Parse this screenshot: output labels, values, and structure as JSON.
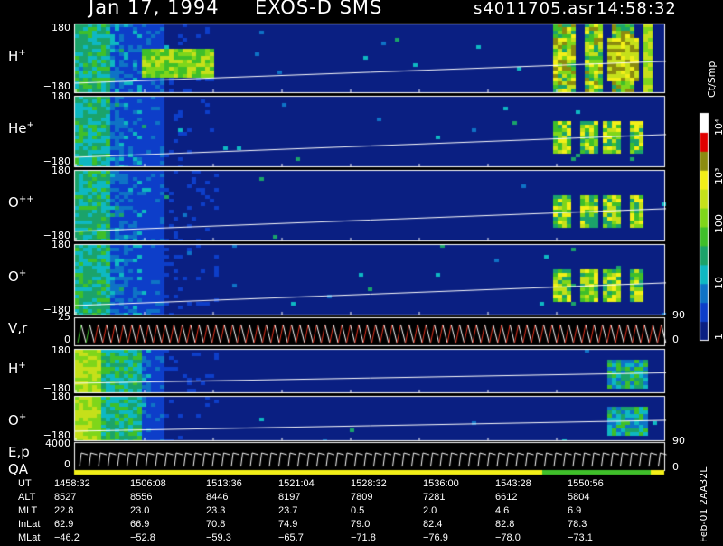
{
  "header": {
    "date": "Jan 17, 1994",
    "mission": "EXOS-D SMS",
    "file": "s4011705.asr",
    "time": "14:58:32"
  },
  "side_labels": {
    "colorbar_unit": "Ct/Smp",
    "footer_id": "Feb-01 2AA32L"
  },
  "colors": {
    "background": "#000000",
    "spectrogram_floor": "#0a1f82",
    "trace": "#ffffff",
    "pitch_trace": "#e8321e"
  },
  "chart_data": {
    "type": "heatmap",
    "panels": [
      {
        "id": "h-plus-1",
        "label_base": "H",
        "label_sup": "+",
        "y_top": "180",
        "y_bottom": "−180",
        "ylim": [
          -180,
          180
        ],
        "intensity": "full"
      },
      {
        "id": "he-plus",
        "label_base": "He",
        "label_sup": "+",
        "y_top": "180",
        "y_bottom": "−180",
        "ylim": [
          -180,
          180
        ],
        "intensity": "heavy"
      },
      {
        "id": "o-plus-plus",
        "label_base": "O",
        "label_sup": "++",
        "y_top": "180",
        "y_bottom": "−180",
        "ylim": [
          -180,
          180
        ],
        "intensity": "heavy"
      },
      {
        "id": "o-plus-1",
        "label_base": "O",
        "label_sup": "+",
        "y_top": "180",
        "y_bottom": "−180",
        "ylim": [
          -180,
          180
        ],
        "intensity": "heavy"
      },
      {
        "id": "vr",
        "label_base": "V,r",
        "label_sup": "",
        "y_top": "25",
        "y_bottom": "0",
        "right_tick": "90",
        "right_tick_bottom": "0"
      },
      {
        "id": "h-plus-2",
        "label_base": "H",
        "label_sup": "+",
        "y_top": "180",
        "y_bottom": "−180",
        "ylim": [
          -180,
          180
        ],
        "intensity": "low"
      },
      {
        "id": "o-plus-2",
        "label_base": "O",
        "label_sup": "+",
        "y_top": "180",
        "y_bottom": "−180",
        "ylim": [
          -180,
          180
        ],
        "intensity": "low"
      },
      {
        "id": "ep-qa",
        "label_base": "E,p",
        "label_sub": "QA",
        "y_top": "4000",
        "y_bottom": "0",
        "right_tick": "90",
        "right_tick_bottom": "0"
      }
    ],
    "colorbar": {
      "scale": "log",
      "range": [
        1,
        20000
      ],
      "ticks": [
        {
          "label": "1",
          "value": 1
        },
        {
          "label": "10",
          "value": 10
        },
        {
          "label": "100",
          "value": 100
        },
        {
          "label": "10³",
          "value": 1000
        },
        {
          "label": "10⁴",
          "value": 10000
        }
      ]
    },
    "time_axis": {
      "rows": [
        {
          "label": "UT",
          "values": [
            "1458:32",
            "1506:08",
            "1513:36",
            "1521:04",
            "1528:32",
            "1536:00",
            "1543:28",
            "1550:56"
          ]
        },
        {
          "label": "ALT",
          "values": [
            "8527",
            "8556",
            "8446",
            "8197",
            "7809",
            "7281",
            "6612",
            "5804"
          ]
        },
        {
          "label": "MLT",
          "values": [
            "22.8",
            "23.0",
            "23.3",
            "23.7",
            "0.5",
            "2.0",
            "4.6",
            "6.9"
          ]
        },
        {
          "label": "InLat",
          "values": [
            "62.9",
            "66.9",
            "70.8",
            "74.9",
            "79.0",
            "82.4",
            "82.8",
            "78.3"
          ]
        },
        {
          "label": "MLat",
          "values": [
            "−46.2",
            "−52.8",
            "−59.3",
            "−65.7",
            "−71.8",
            "−76.9",
            "−78.0",
            "−73.1"
          ]
        }
      ]
    }
  }
}
